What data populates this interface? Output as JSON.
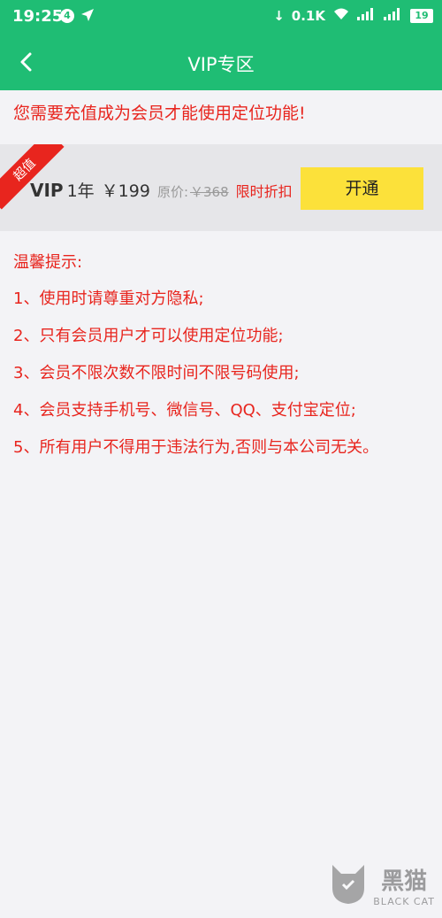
{
  "status_bar": {
    "time": "19:25",
    "notification_count": "4",
    "network_speed": "0.1K",
    "battery": "19"
  },
  "header": {
    "title": "VIP专区"
  },
  "notice": "您需要充值成为会员才能使用定位功能!",
  "vip_offer": {
    "ribbon": "超值",
    "vip_label": "VIP",
    "duration": "1年",
    "price": "￥199",
    "original_label": "原价:",
    "original_price": "￥368",
    "discount": "限时折扣",
    "button_label": "开通"
  },
  "tips": {
    "title": "温馨提示:",
    "items": [
      "1、使用时请尊重对方隐私;",
      "2、只有会员用户才可以使用定位功能;",
      "3、会员不限次数不限时间不限号码使用;",
      "4、会员支持手机号、微信号、QQ、支付宝定位;",
      "5、所有用户不得用于违法行为,否则与本公司无关。"
    ]
  },
  "watermark": {
    "cn": "黑猫",
    "en": "BLACK CAT"
  },
  "colors": {
    "primary": "#1fbd74",
    "accent_red": "#e8251e",
    "button_yellow": "#fce13a"
  }
}
